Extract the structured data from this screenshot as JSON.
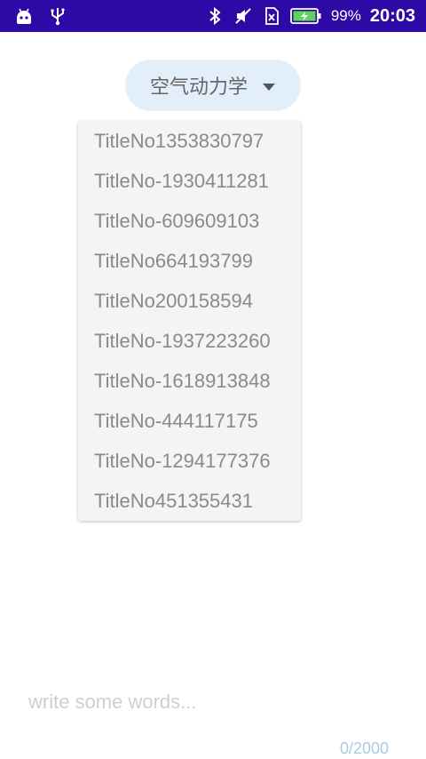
{
  "status_bar": {
    "icons_left": [
      "android-robot-icon",
      "usb-icon"
    ],
    "icons_right": [
      "bluetooth-icon",
      "muted-icon",
      "sim-icon",
      "battery-charging-icon"
    ],
    "battery_percent": "99%",
    "time": "20:03",
    "background_color": "#2d0aa6"
  },
  "dropdown": {
    "selected": "空气动力学",
    "background_color": "#e2eefa"
  },
  "menu": {
    "items": [
      "TitleNo1353830797",
      "TitleNo-1930411281",
      "TitleNo-609609103",
      "TitleNo664193799",
      "TitleNo200158594",
      "TitleNo-1937223260",
      "TitleNo-1618913848",
      "TitleNo-444117175",
      "TitleNo-1294177376",
      "TitleNo451355431"
    ]
  },
  "input": {
    "placeholder": "write some words...",
    "value": ""
  },
  "counter": "0/2000"
}
